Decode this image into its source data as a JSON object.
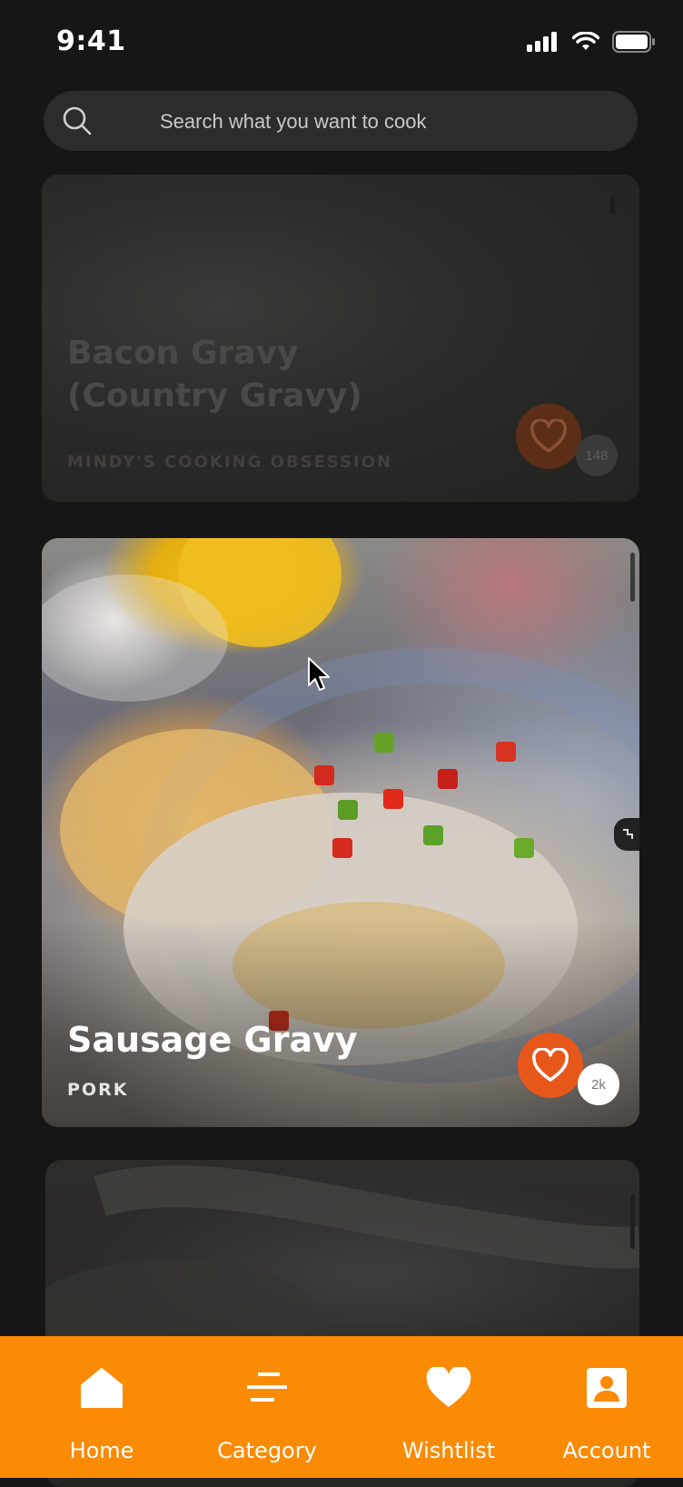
{
  "status_bar": {
    "time": "9:41"
  },
  "search": {
    "placeholder": "Search what you want to cook"
  },
  "recipes": [
    {
      "title_line1": "Bacon Gravy",
      "title_line2": "(Country Gravy)",
      "subtitle": "MINDY'S COOKING OBSESSION",
      "likes": "148"
    },
    {
      "title": "Sausage Gravy",
      "subtitle": "PORK",
      "likes": "2k"
    }
  ],
  "bottom_nav": {
    "items": [
      {
        "label": "Home",
        "icon": "home-icon"
      },
      {
        "label": "Category",
        "icon": "category-icon"
      },
      {
        "label": "Wishtlist",
        "icon": "heart-icon"
      },
      {
        "label": "Account",
        "icon": "account-icon"
      }
    ]
  },
  "colors": {
    "accent": "#fb8a05",
    "like": "#e8571a",
    "background": "#161616"
  }
}
